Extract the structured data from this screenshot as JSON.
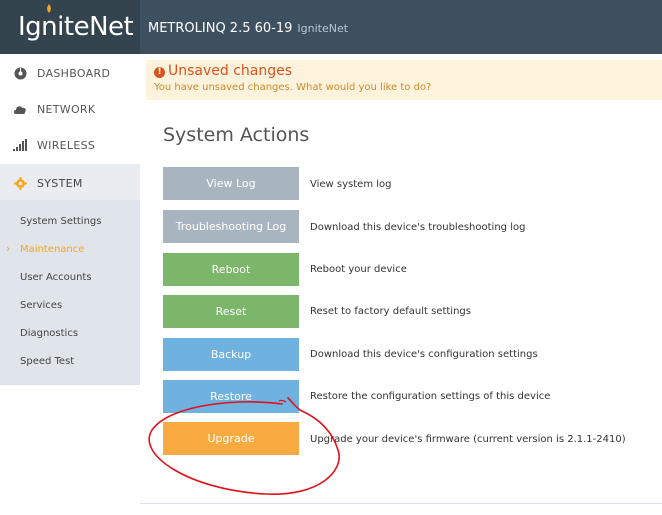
{
  "brand": {
    "logo_text": "IgniteNet",
    "device_name": "METROLINQ 2.5 60-19",
    "device_host": "IgniteNet"
  },
  "sidebar": {
    "items": [
      {
        "label": "DASHBOARD",
        "icon": "dashboard-icon"
      },
      {
        "label": "NETWORK",
        "icon": "cloud-icon"
      },
      {
        "label": "WIRELESS",
        "icon": "signal-bars-icon"
      },
      {
        "label": "SYSTEM",
        "icon": "gear-icon"
      }
    ],
    "submenu": [
      {
        "label": "System Settings"
      },
      {
        "label": "Maintenance"
      },
      {
        "label": "User Accounts"
      },
      {
        "label": "Services"
      },
      {
        "label": "Diagnostics"
      },
      {
        "label": "Speed Test"
      }
    ]
  },
  "alert": {
    "title": "Unsaved changes",
    "text": "You have unsaved changes. What would you like to do?"
  },
  "main": {
    "title": "System Actions",
    "actions": [
      {
        "label": "View Log",
        "description": "View system log"
      },
      {
        "label": "Troubleshooting Log",
        "description": "Download this device's troubleshooting log"
      },
      {
        "label": "Reboot",
        "description": "Reboot your device"
      },
      {
        "label": "Reset",
        "description": "Reset to factory default settings"
      },
      {
        "label": "Backup",
        "description": "Download this device's configuration settings"
      },
      {
        "label": "Restore",
        "description": "Restore the configuration settings of this device"
      },
      {
        "label": "Upgrade",
        "description": "Upgrade your device's firmware (current version is 2.1.1-2410)"
      }
    ]
  },
  "colors": {
    "accent": "#f5a623",
    "topbar": "#3d5060",
    "alert_bg": "#fdf3dc",
    "annotation": "#e0121b"
  }
}
